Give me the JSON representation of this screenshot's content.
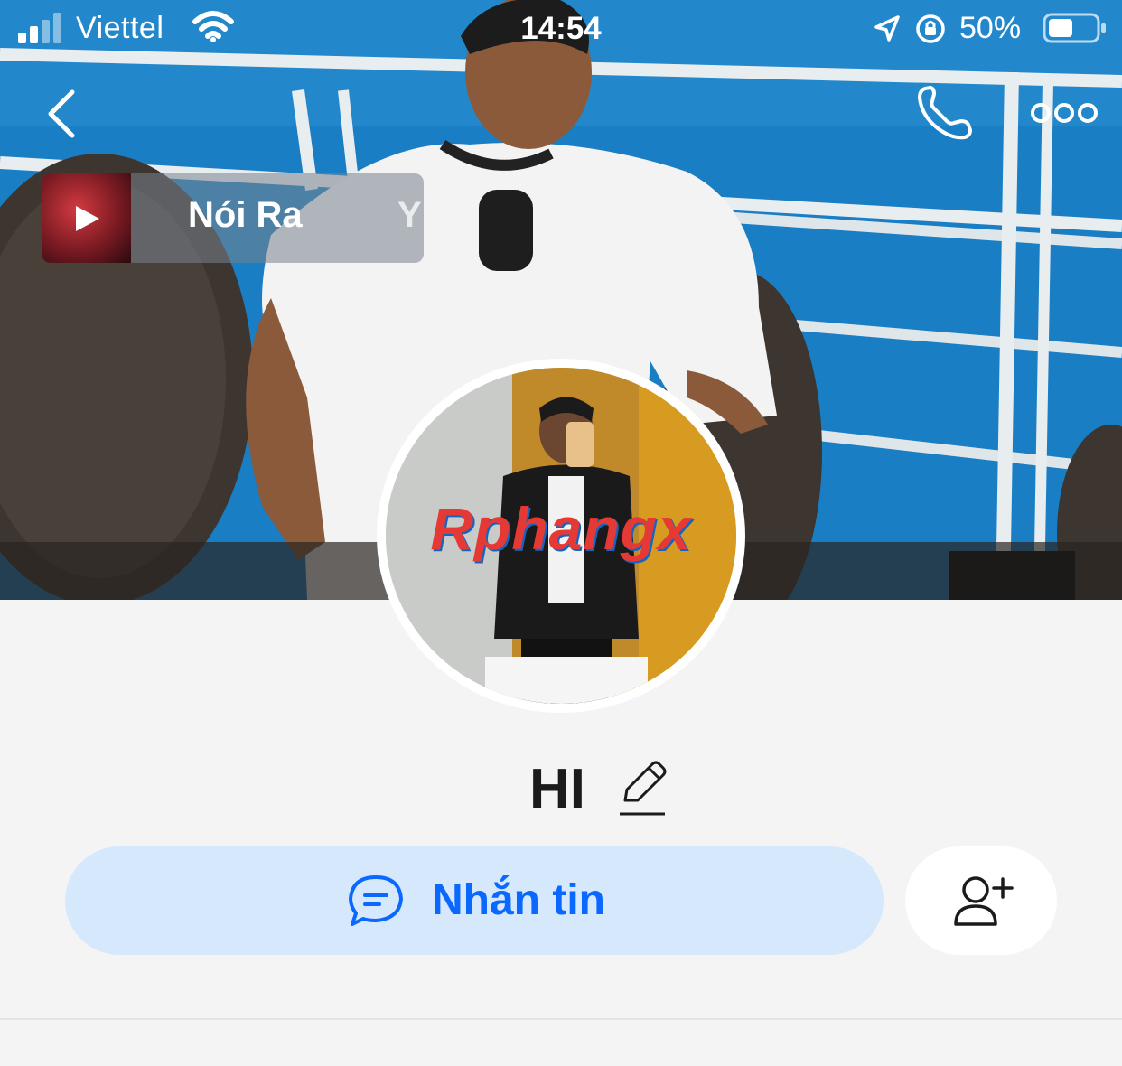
{
  "status_bar": {
    "carrier": "Viettel",
    "time": "14:54",
    "battery_percent": "50%"
  },
  "icons": {
    "back": "chevron-left-icon",
    "call": "phone-icon",
    "more": "more-dots-icon",
    "play": "play-icon",
    "edit": "pencil-icon",
    "message": "chat-bubble-icon",
    "add_friend": "add-user-icon"
  },
  "music": {
    "title": "Nói Ra",
    "extra": "Y"
  },
  "avatar": {
    "watermark": "Rphangx"
  },
  "profile": {
    "name": "HI"
  },
  "actions": {
    "message_label": "Nhắn tin"
  },
  "colors": {
    "accent": "#0a68ff",
    "message_button_bg": "#d5e8fc",
    "page_bg": "#f4f4f5"
  }
}
